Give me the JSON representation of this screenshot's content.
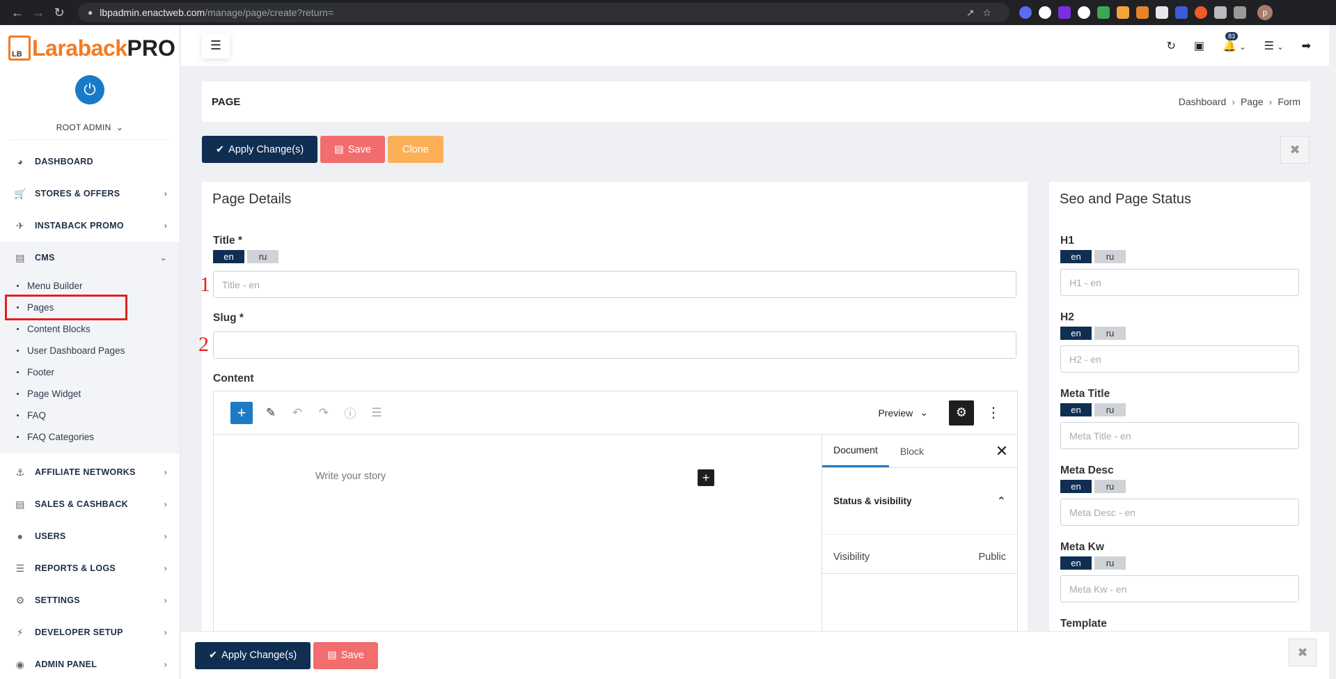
{
  "browser": {
    "url_host": "lbpadmin.enactweb.com",
    "url_path": "/manage/page/create?return=",
    "avatar_letter": "p"
  },
  "brand": {
    "name_a": "Laraback",
    "name_b": "PRO",
    "color": "#f47b20"
  },
  "user": {
    "name": "ROOT ADMIN"
  },
  "sidebar": {
    "items": [
      {
        "label": "DASHBOARD",
        "icon": "dashboard-icon"
      },
      {
        "label": "STORES & OFFERS",
        "icon": "cart-icon"
      },
      {
        "label": "INSTABACK PROMO",
        "icon": "plane-icon"
      },
      {
        "label": "CMS",
        "icon": "cms-icon"
      },
      {
        "label": "AFFILIATE NETWORKS",
        "icon": "anchor-icon"
      },
      {
        "label": "SALES & CASHBACK",
        "icon": "money-icon"
      },
      {
        "label": "USERS",
        "icon": "users-icon"
      },
      {
        "label": "REPORTS & LOGS",
        "icon": "list-icon"
      },
      {
        "label": "SETTINGS",
        "icon": "gears-icon"
      },
      {
        "label": "DEVELOPER SETUP",
        "icon": "plug-icon"
      },
      {
        "label": "ADMIN PANEL",
        "icon": "dial-icon"
      }
    ],
    "cms_sub": [
      "Menu Builder",
      "Pages",
      "Content Blocks",
      "User Dashboard Pages",
      "Footer",
      "Page Widget",
      "FAQ",
      "FAQ Categories"
    ]
  },
  "topbar": {
    "notification_count": "83"
  },
  "header": {
    "title": "PAGE",
    "breadcrumb": [
      "Dashboard",
      "Page",
      "Form"
    ]
  },
  "actions": {
    "apply": "Apply Change(s)",
    "save": "Save",
    "clone": "Clone"
  },
  "details": {
    "title": "Page Details",
    "title_label": "Title *",
    "title_placeholder": "Title - en",
    "slug_label": "Slug *",
    "content_label": "Content",
    "lang_en": "en",
    "lang_ru": "ru"
  },
  "annotations": {
    "one": "1",
    "two": "2"
  },
  "editor": {
    "preview": "Preview",
    "placeholder": "Write your story",
    "tab_document": "Document",
    "tab_block": "Block",
    "section": "Status & visibility",
    "visibility_label": "Visibility",
    "visibility_value": "Public"
  },
  "seo": {
    "title": "Seo and Page Status",
    "fields": [
      {
        "label": "H1",
        "placeholder": "H1 - en"
      },
      {
        "label": "H2",
        "placeholder": "H2 - en"
      },
      {
        "label": "Meta Title",
        "placeholder": "Meta Title - en"
      },
      {
        "label": "Meta Desc",
        "placeholder": "Meta Desc - en"
      },
      {
        "label": "Meta Kw",
        "placeholder": "Meta Kw - en"
      }
    ],
    "template_label": "Template"
  }
}
